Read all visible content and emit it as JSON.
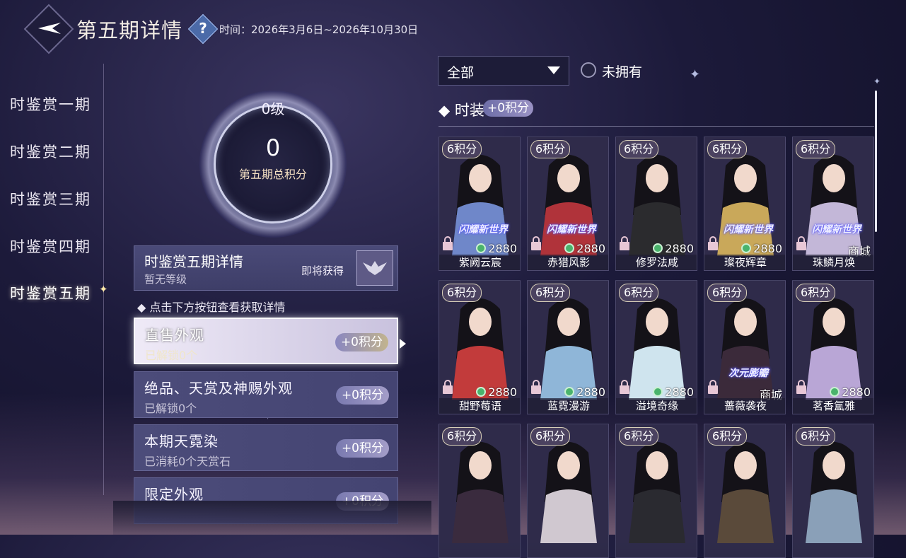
{
  "header": {
    "title": "第五期详情",
    "date_range": "时间：2026年3月6日~2026年10月30日"
  },
  "sidebar": {
    "items": [
      {
        "label": "时鉴赏一期"
      },
      {
        "label": "时鉴赏二期"
      },
      {
        "label": "时鉴赏三期"
      },
      {
        "label": "时鉴赏四期"
      },
      {
        "label": "时鉴赏五期"
      }
    ],
    "active_index": 4
  },
  "orb": {
    "level": "0级",
    "score": "0",
    "label": "第五期总积分"
  },
  "detail": {
    "title": "时鉴赏五期详情",
    "sub": "暂无等级",
    "upcoming": "即将获得"
  },
  "hint": "◆ 点击下方按钮查看获取详情",
  "categories": [
    {
      "title": "直售外观",
      "sub": "已解锁0个",
      "badge": "+0积分"
    },
    {
      "title": "绝品、天赏及神赐外观",
      "sub": "已解锁0个",
      "badge": "+0积分"
    },
    {
      "title": "本期天霓染",
      "sub": "已消耗0个天赏石",
      "badge": "+0积分"
    },
    {
      "title": "限定外观",
      "sub": "",
      "badge": "+0积分"
    }
  ],
  "filter": {
    "dropdown_value": "全部",
    "unowned_label": "未拥有"
  },
  "section": {
    "title": "时装",
    "badge": "+0积分"
  },
  "items": [
    {
      "points": "6积分",
      "event": "闪耀新世界",
      "price": "2880",
      "name": "紫阙云宸",
      "hue": "#6f87c9"
    },
    {
      "points": "6积分",
      "event": "闪耀新世界",
      "price": "2880",
      "name": "赤猎风影",
      "hue": "#b0333a"
    },
    {
      "points": "6积分",
      "event": "",
      "price": "2880",
      "name": "修罗法咸",
      "hue": "#2b2b2e"
    },
    {
      "points": "6积分",
      "event": "闪耀新世界",
      "price": "2880",
      "name": "璨夜辉章",
      "hue": "#c9a85a"
    },
    {
      "points": "6积分",
      "event": "闪耀新世界",
      "price": "商城",
      "name": "珠鳞月焕",
      "hue": "#c3b7d8"
    },
    {
      "points": "6积分",
      "event": "",
      "price": "2880",
      "name": "甜野莓语",
      "hue": "#c23b3b"
    },
    {
      "points": "6积分",
      "event": "",
      "price": "2880",
      "name": "蓝霓漫游",
      "hue": "#8fb6d8"
    },
    {
      "points": "6积分",
      "event": "",
      "price": "2880",
      "name": "溢境奇缘",
      "hue": "#cfe4ee"
    },
    {
      "points": "6积分",
      "event": "次元膨瓣",
      "price": "商城",
      "name": "蔷薇袭夜",
      "hue": "#3b2a3a"
    },
    {
      "points": "6积分",
      "event": "",
      "price": "2880",
      "name": "茗香氲雅",
      "hue": "#b9a6d6"
    },
    {
      "points": "6积分",
      "event": "",
      "price": "",
      "name": "",
      "hue": "#3a2b3e"
    },
    {
      "points": "6积分",
      "event": "",
      "price": "",
      "name": "",
      "hue": "#d0c8d0"
    },
    {
      "points": "6积分",
      "event": "",
      "price": "",
      "name": "",
      "hue": "#2a2a30"
    },
    {
      "points": "6积分",
      "event": "",
      "price": "",
      "name": "",
      "hue": "#5a4a3a"
    },
    {
      "points": "6积分",
      "event": "",
      "price": "",
      "name": "",
      "hue": "#8aa0b8"
    }
  ]
}
